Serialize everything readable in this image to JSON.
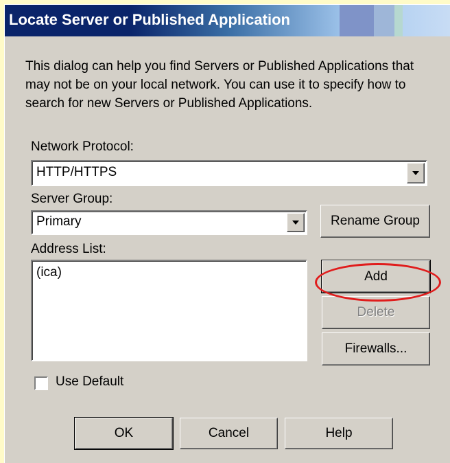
{
  "window": {
    "title": "Locate Server or Published Application"
  },
  "description": "This dialog can help you find Servers or Published Applications that may not be on your local network.  You can use it to specify how to search for new Servers or Published Applications.",
  "network_protocol": {
    "label": "Network Protocol:",
    "value": "HTTP/HTTPS"
  },
  "server_group": {
    "label": "Server Group:",
    "value": "Primary",
    "rename_button": "Rename Group"
  },
  "address_list": {
    "label": "Address List:",
    "items": [
      "(ica)"
    ]
  },
  "side_buttons": {
    "add": "Add",
    "delete": "Delete",
    "firewalls": "Firewalls..."
  },
  "use_default": {
    "label": "Use Default",
    "checked": false
  },
  "footer_buttons": {
    "ok": "OK",
    "cancel": "Cancel",
    "help": "Help"
  },
  "colors": {
    "title_bar": "#0a246a",
    "dialog_face": "#d4d0c8",
    "annotation": "#e01c1c",
    "page_background": "#fffbc8"
  },
  "icons": {
    "dropdown": "chevron-down-icon",
    "annotation": "red-ellipse-highlight"
  }
}
